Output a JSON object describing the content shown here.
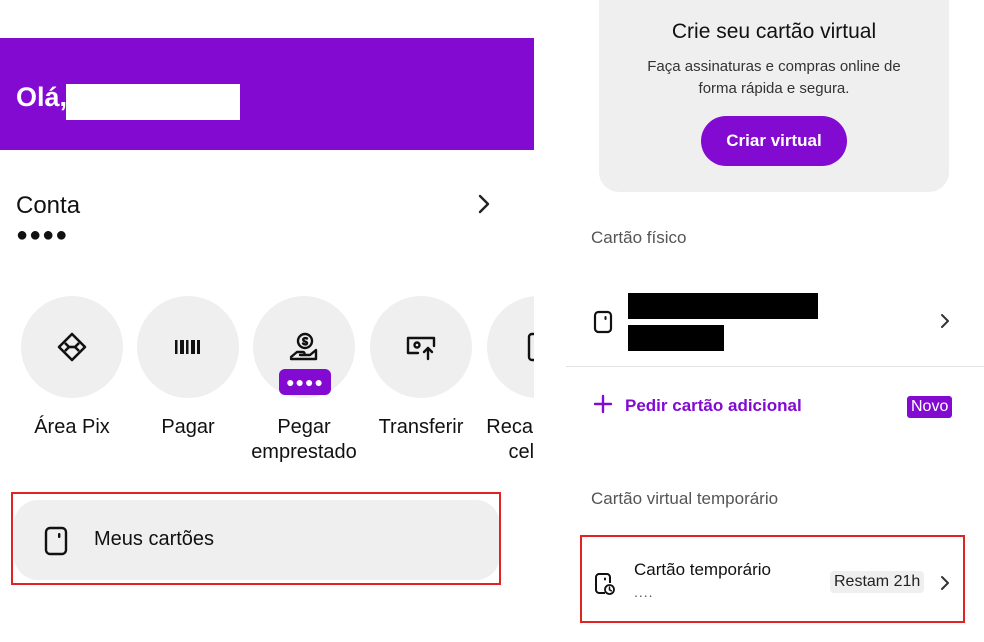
{
  "left": {
    "greeting": "Olá,",
    "account": {
      "title": "Conta",
      "balance_mask": "●●●●"
    },
    "actions": [
      {
        "label": "Área Pix",
        "icon": "pix-icon"
      },
      {
        "label": "Pagar",
        "icon": "barcode-icon"
      },
      {
        "label": "Pegar emprestado",
        "icon": "loan-icon",
        "badge": "●●●●"
      },
      {
        "label": "Transferir",
        "icon": "transfer-icon"
      },
      {
        "label": "Recarga de celular",
        "icon": "phone-icon"
      }
    ],
    "my_cards": {
      "label": "Meus cartões",
      "icon": "card-icon"
    }
  },
  "right": {
    "promo": {
      "title": "Crie seu cartão virtual",
      "subtitle": "Faça assinaturas e compras online de forma rápida e segura.",
      "button": "Criar virtual"
    },
    "physical": {
      "section": "Cartão físico"
    },
    "add_card": {
      "label": "Pedir cartão adicional",
      "badge": "Novo"
    },
    "temporary": {
      "section": "Cartão virtual temporário",
      "title": "Cartão temporário",
      "mask": "....",
      "remaining": "Restam 21h"
    }
  },
  "colors": {
    "brand": "#820ad1",
    "highlight": "#e02424",
    "surface": "#efefef"
  }
}
